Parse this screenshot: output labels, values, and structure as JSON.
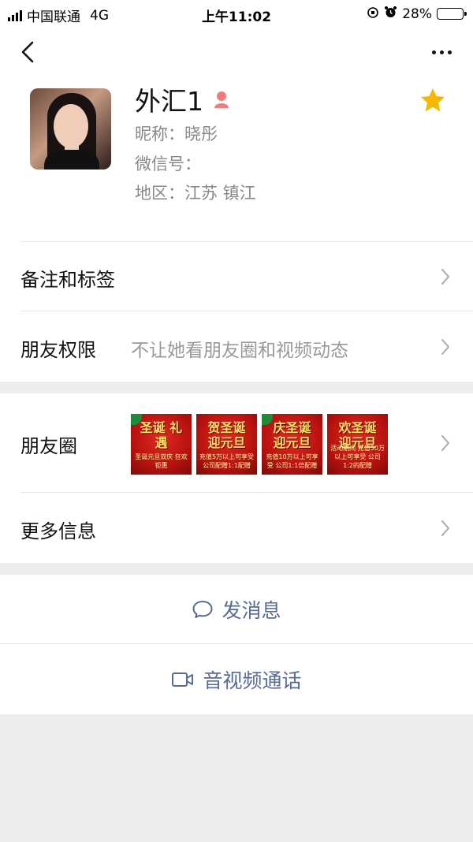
{
  "status_bar": {
    "carrier": "中国联通",
    "network": "4G",
    "time": "上午11:02",
    "battery": "28%",
    "battery_level": 0.28
  },
  "profile": {
    "name": "外汇1",
    "nickname": "昵称：晓彤",
    "wechat_id": "微信号：",
    "region": "地区：江苏 镇江",
    "gender_icon": "female-icon",
    "star_color": "#f5b800"
  },
  "rows": {
    "remark_label": "备注和标签",
    "permission_label": "朋友权限",
    "permission_value": "不让她看朋友圈和视频动态",
    "moments_label": "朋友圈",
    "more_info_label": "更多信息"
  },
  "moments_thumbs": [
    {
      "title": "圣诞 礼遇",
      "caption": "圣诞元旦双庆 狂欢钜惠"
    },
    {
      "title": "贺圣诞 迎元旦",
      "caption": "充值5万以上可享受 公司配赠1:1配赠"
    },
    {
      "title": "庆圣诞 迎元旦",
      "caption": "充值10万以上可享受 公司1:1倍配赠"
    },
    {
      "title": "欢圣诞 迎元旦",
      "caption": "活动期间 充值30万以上可享受 公司1:2的配赠"
    }
  ],
  "actions": {
    "message_label": "发消息",
    "call_label": "音视频通话"
  },
  "colors": {
    "link": "#576b95",
    "background": "#ededed"
  }
}
